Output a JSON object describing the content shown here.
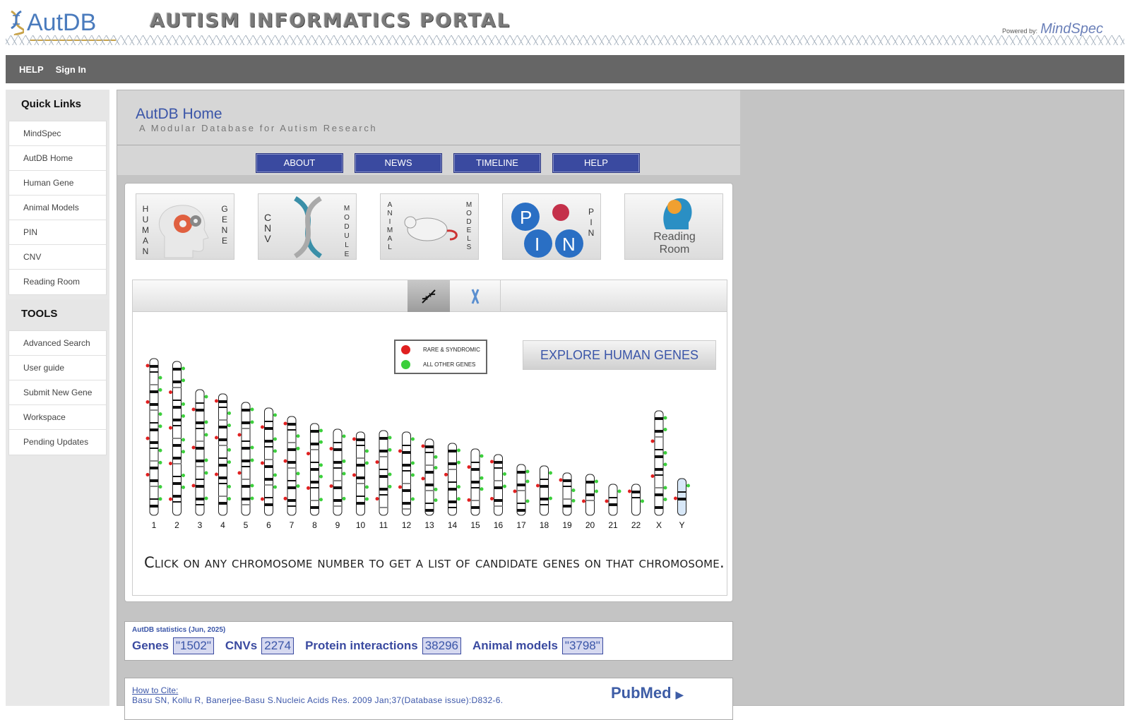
{
  "header": {
    "logo_text": "AutDB",
    "portal_title": "AUTISM INFORMATICS PORTAL",
    "powered_by": "Powered by:",
    "powered_brand": "MindSpec"
  },
  "navbar": {
    "items": [
      "HELP",
      "Sign In"
    ]
  },
  "sidebar": {
    "quick_links_title": "Quick Links",
    "quick_links": [
      "MindSpec",
      "AutDB Home",
      "Human Gene",
      "Animal Models",
      "PIN",
      "CNV",
      "Reading Room"
    ],
    "tools_title": "TOOLS",
    "tools": [
      "Advanced Search",
      "User guide",
      "Submit New Gene",
      "Workspace",
      "Pending Updates"
    ]
  },
  "main": {
    "title": "AutDB Home",
    "subtitle": "A Modular Database for Autism Research",
    "buttons": [
      "ABOUT",
      "NEWS",
      "TIMELINE",
      "HELP"
    ],
    "modules": {
      "human_gene": {
        "left": "HUMAN",
        "right": "GENE"
      },
      "cnv": {
        "left": "CNV",
        "right": "MODULE"
      },
      "animal": {
        "left": "ANIMAL",
        "right": "MODELS"
      },
      "pin": {
        "letters": "PIN",
        "right": "PIN"
      },
      "reading": {
        "label": "Reading Room"
      }
    },
    "legend": {
      "rare": "RARE & SYNDROMIC",
      "other": "ALL OTHER GENES"
    },
    "explore_label": "EXPLORE HUMAN GENES",
    "chromosomes": [
      "1",
      "2",
      "3",
      "4",
      "5",
      "6",
      "7",
      "8",
      "9",
      "10",
      "11",
      "12",
      "13",
      "14",
      "15",
      "16",
      "17",
      "18",
      "19",
      "20",
      "21",
      "22",
      "X",
      "Y"
    ],
    "caption": "Click on any chromosome number to get a list of candidate genes on that chromosome."
  },
  "stats": {
    "title": "AutDB statistics (Jun, 2025)",
    "genes_label": "Genes",
    "genes_value": "\"1502\"",
    "cnvs_label": "CNVs",
    "cnvs_value": "2274",
    "pi_label": "Protein interactions",
    "pi_value": "38296",
    "animal_label": "Animal models",
    "animal_value": "\"3798\""
  },
  "cite": {
    "link": "How to Cite:",
    "text": "Basu SN, Kollu R, Banerjee-Basu S.Nucleic Acids Res. 2009 Jan;37(Database issue):D832-6.",
    "pubmed": "PubMed"
  },
  "colors": {
    "accent": "#3a4aa0",
    "rare": "#e02020",
    "other": "#3ccf3c",
    "nav": "#666666"
  },
  "icons": [
    "dna-icon",
    "chromosome-icon",
    "pubmed-arrow-icon"
  ]
}
